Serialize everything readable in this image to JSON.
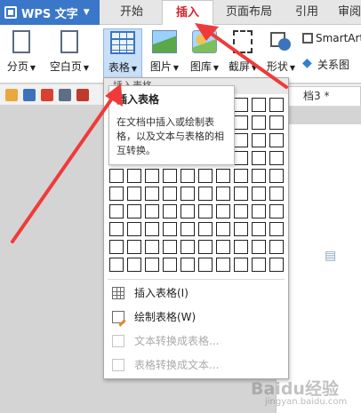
{
  "app": {
    "name": "WPS 文字"
  },
  "tabs": [
    {
      "label": "开始"
    },
    {
      "label": "插入"
    },
    {
      "label": "页面布局"
    },
    {
      "label": "引用"
    },
    {
      "label": "审阅"
    }
  ],
  "ribbon": {
    "page_break": "分页",
    "blank_page": "空白页",
    "table": "表格",
    "picture": "图片",
    "gallery": "图库",
    "screenshot": "截屏",
    "shape": "形状",
    "smartart": "SmartArt",
    "relation": "关系图"
  },
  "document": {
    "tab_label": "档3 *"
  },
  "dropdown": {
    "header": "插入表格",
    "items": [
      {
        "label": "插入表格(I)"
      },
      {
        "label": "绘制表格(W)"
      },
      {
        "label": "文本转换成表格..."
      },
      {
        "label": "表格转换成文本..."
      }
    ]
  },
  "tooltip": {
    "title": "插入表格",
    "body": "在文档中插入或绘制表格，以及文本与表格的相互转换。"
  },
  "watermark": {
    "text": "Baidu经验",
    "url": "jingyan.baidu.com"
  },
  "colors": {
    "accent": "#3a77c9",
    "active_tab_text": "#d9232d",
    "annotation_arrow": "#f03a3a"
  }
}
